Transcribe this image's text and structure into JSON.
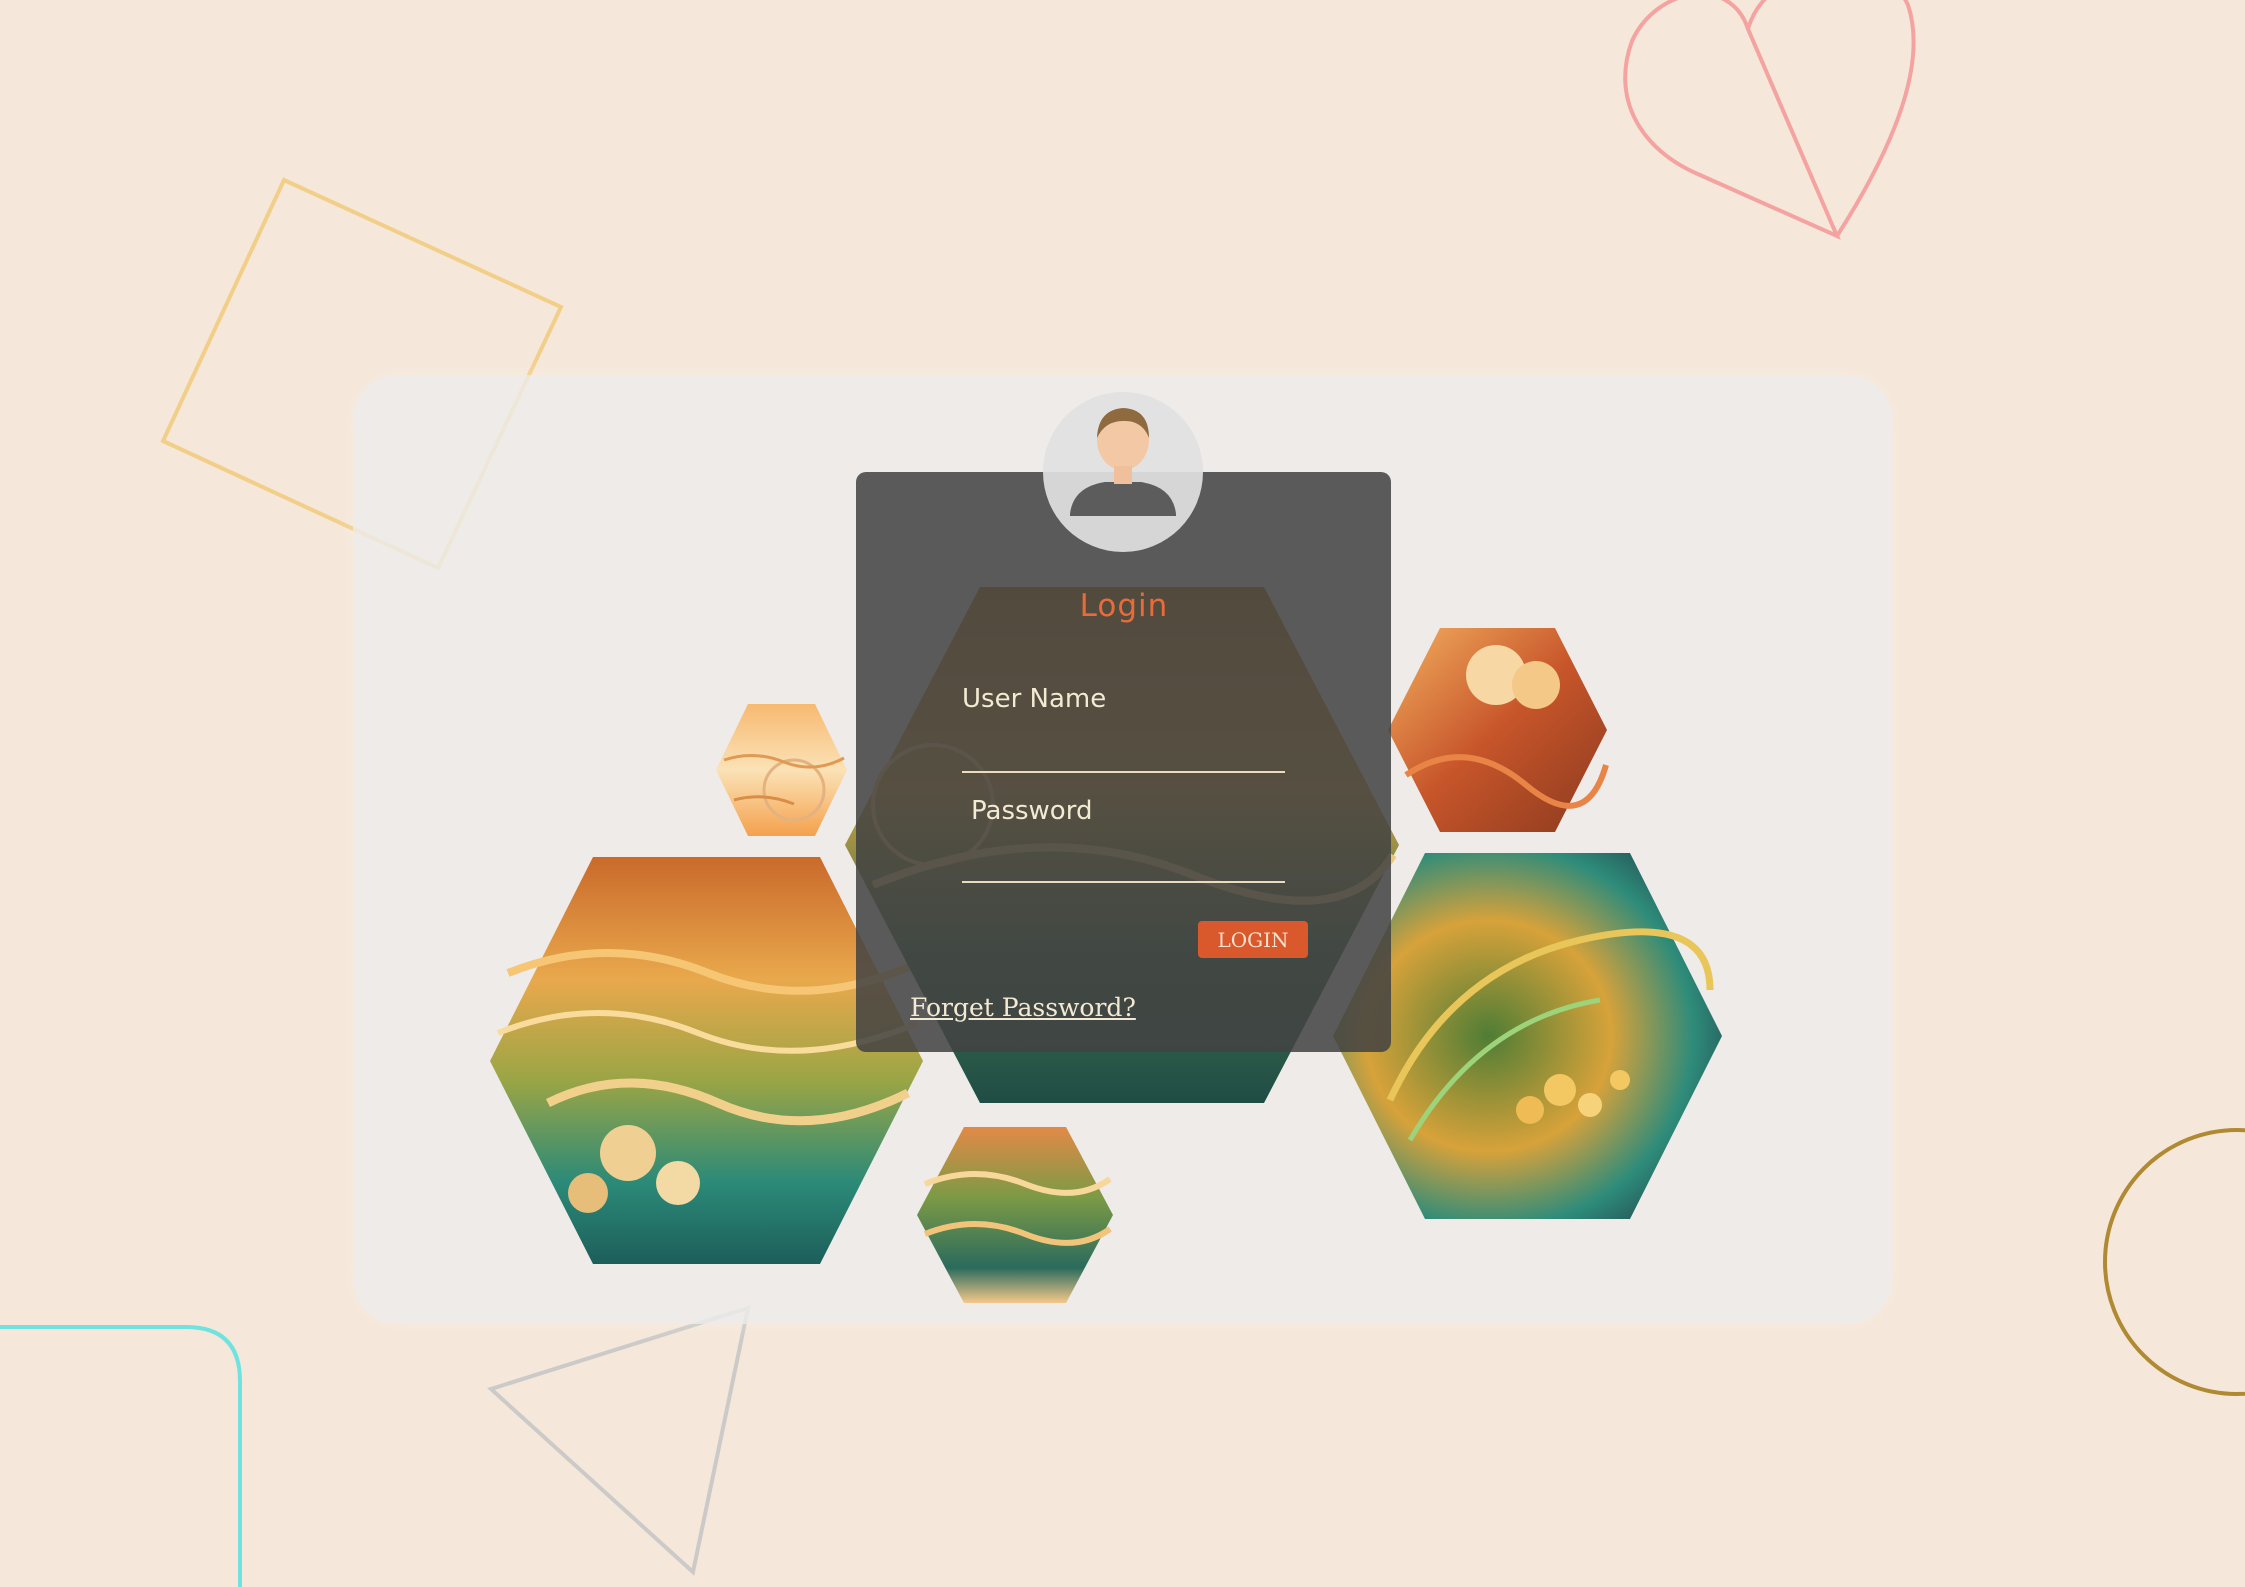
{
  "login": {
    "title": "Login",
    "username_label": "User Name",
    "username_value": "",
    "password_label": "Password",
    "password_value": "",
    "button_label": "LOGIN",
    "forgot_label": "Forget Password?"
  },
  "icons": {
    "avatar": "user-avatar-icon",
    "decorations": [
      "heart-outline",
      "square-outline",
      "triangle-outline",
      "circle-outline",
      "rounded-rect-outline"
    ]
  },
  "colors": {
    "background": "#f5e7d9",
    "card": "#ececec",
    "panel": "#424242",
    "accent": "#e86b3a",
    "button": "#d9582c",
    "text_light": "#f3ead4"
  }
}
